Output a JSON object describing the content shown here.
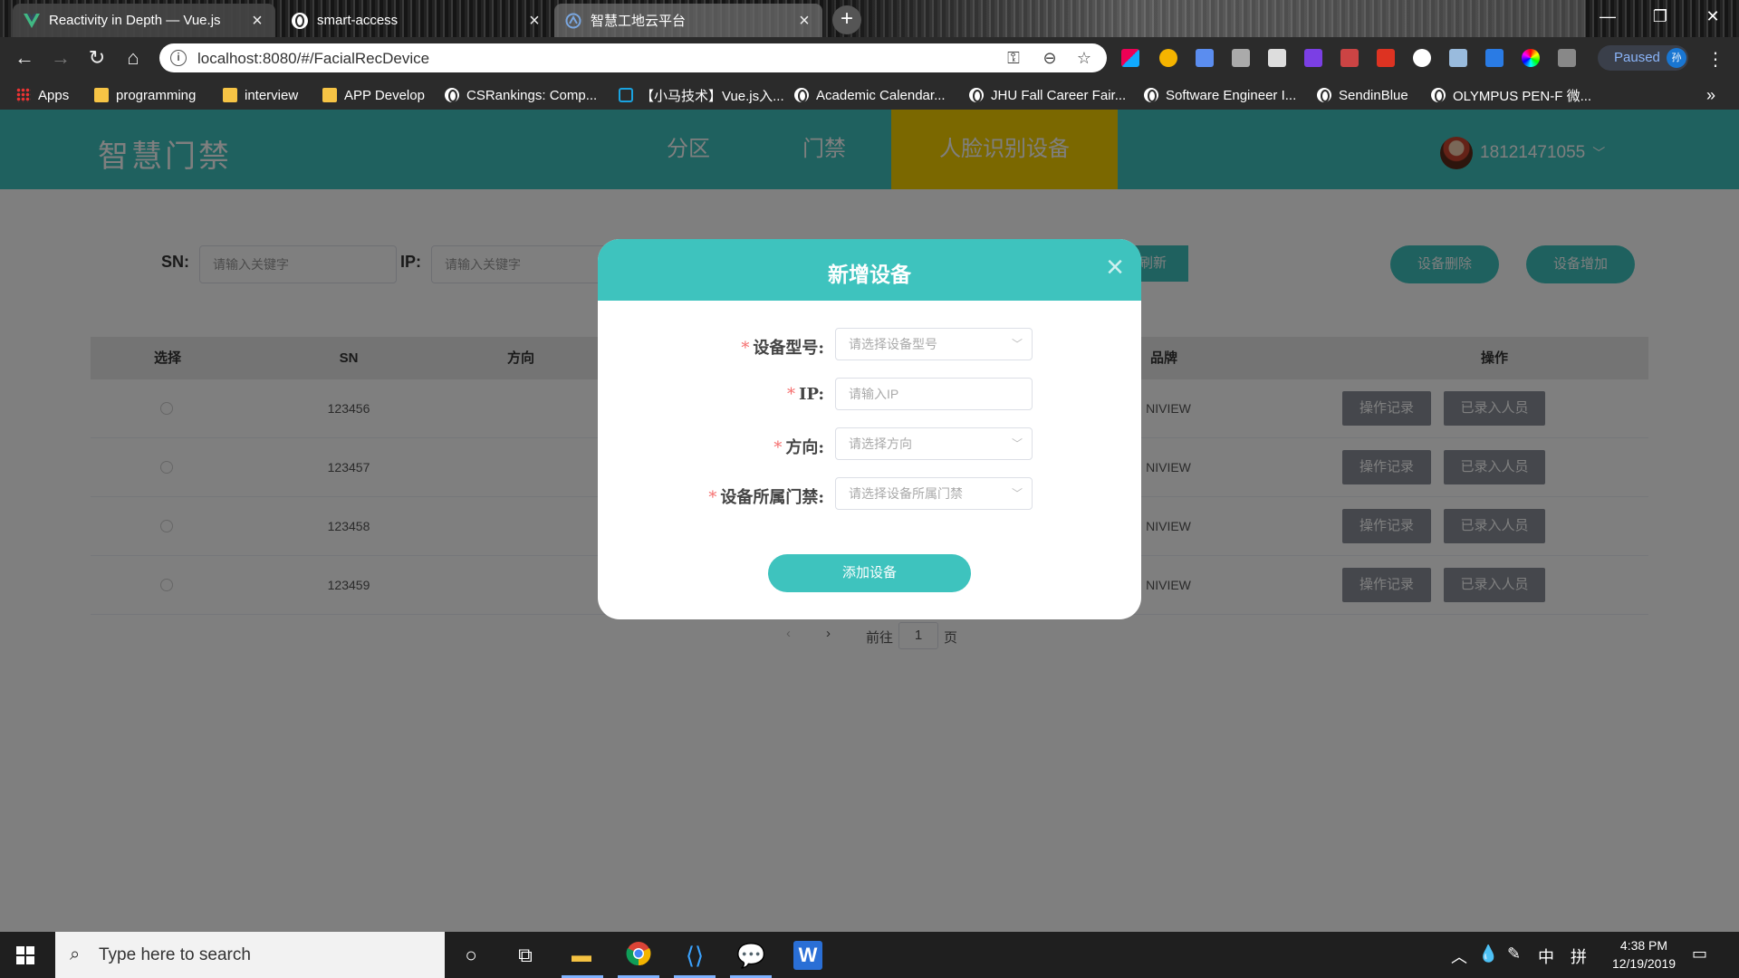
{
  "browser": {
    "tabs": [
      {
        "label": "Reactivity in Depth — Vue.js",
        "icon": "vue-icon"
      },
      {
        "label": "smart-access",
        "icon": "globe-icon"
      },
      {
        "label": "智慧工地云平台",
        "icon": "platform-icon"
      }
    ],
    "url": "localhost:8080/#/FacialRecDevice",
    "profile_status": "Paused",
    "profile_initial": "孙",
    "bookmarks": [
      {
        "label": "Apps",
        "icon": "apps-grid-icon"
      },
      {
        "label": "programming",
        "icon": "folder-icon"
      },
      {
        "label": "interview",
        "icon": "folder-icon"
      },
      {
        "label": "APP Develop",
        "icon": "folder-icon"
      },
      {
        "label": "CSRankings: Comp...",
        "icon": "globe-icon"
      },
      {
        "label": "【小马技术】Vue.js入...",
        "icon": "bilibili-icon"
      },
      {
        "label": "Academic Calendar...",
        "icon": "globe-icon"
      },
      {
        "label": "JHU Fall Career Fair...",
        "icon": "globe-icon"
      },
      {
        "label": "Software Engineer I...",
        "icon": "globe-icon"
      },
      {
        "label": "SendinBlue",
        "icon": "globe-icon"
      },
      {
        "label": "OLYMPUS PEN-F 微...",
        "icon": "globe-icon"
      }
    ],
    "more_bookmarks": "»"
  },
  "app": {
    "brand": "智慧门禁",
    "nav": [
      "分区",
      "门禁",
      "人脸识别设备"
    ],
    "active_nav": "人脸识别设备",
    "user_phone": "18121471055",
    "colors": {
      "primary": "#3ec3be",
      "active_nav": "#f7d100",
      "op_button": "#8a8f99",
      "required": "#f56c6c"
    }
  },
  "filters": {
    "sn_label": "SN:",
    "sn_placeholder": "请输入关键字",
    "ip_label": "IP:",
    "ip_placeholder": "请输入关键字",
    "refresh_label": "刷新",
    "delete_label": "设备删除",
    "add_label": "设备增加"
  },
  "table": {
    "columns": {
      "select": "选择",
      "sn": "SN",
      "direction": "方向",
      "brand": "品牌",
      "actions": "操作"
    },
    "rows": [
      {
        "sn": "123456",
        "brand": "NIVIEW"
      },
      {
        "sn": "123457",
        "brand": "NIVIEW"
      },
      {
        "sn": "123458",
        "brand": "NIVIEW"
      },
      {
        "sn": "123459",
        "brand": "NIVIEW"
      }
    ],
    "op_record_label": "操作记录",
    "op_people_label": "已录入人员"
  },
  "pagination": {
    "prev": "‹",
    "next": "›",
    "goto_label": "前往",
    "page": "1",
    "page_suffix": "页"
  },
  "modal": {
    "title": "新增设备",
    "close_icon": "×",
    "fields": [
      {
        "label": "设备型号:",
        "placeholder": "请选择设备型号",
        "type": "select"
      },
      {
        "label": "IP:",
        "placeholder": "请输入IP",
        "type": "input"
      },
      {
        "label": "方向:",
        "placeholder": "请选择方向",
        "type": "select"
      },
      {
        "label": "设备所属门禁:",
        "placeholder": "请选择设备所属门禁",
        "type": "select"
      }
    ],
    "required_mark": "*",
    "submit_label": "添加设备"
  },
  "taskbar": {
    "search_placeholder": "Type here to search",
    "time": "4:38 PM",
    "date": "12/19/2019",
    "ime_lang": "中",
    "ime_mode": "拼"
  }
}
